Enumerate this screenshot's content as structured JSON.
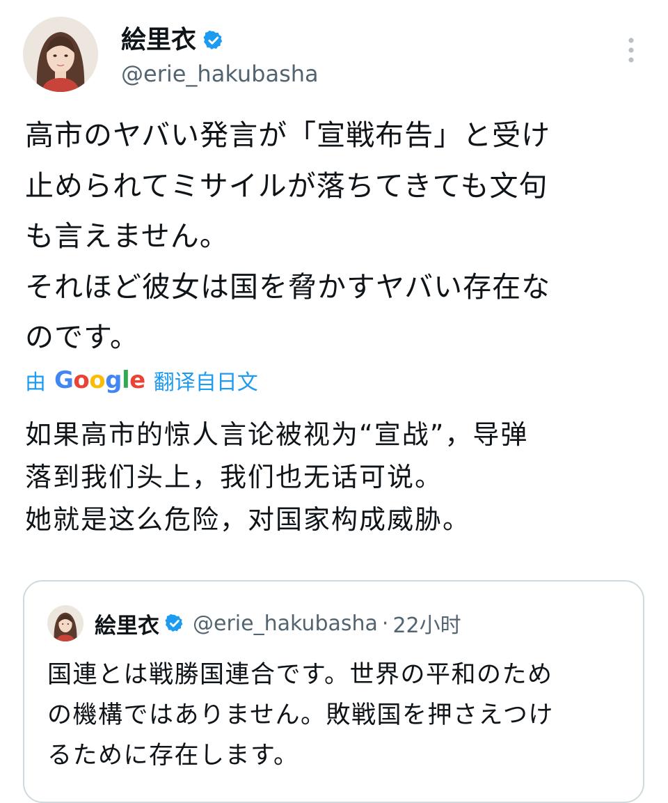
{
  "tweet": {
    "author": {
      "display_name": "絵里衣",
      "handle": "@erie_hakubasha",
      "verified": true,
      "avatar_icon": "avatar-icon",
      "verified_icon": "verified-badge-icon"
    },
    "more_icon": "more-vertical-icon",
    "text_lines": [
      "高市のヤバい発言が「宣戦布告」と受け",
      "止められてミサイルが落ちてきても文句",
      "も言えません。",
      "それほど彼女は国を脅かすヤバい存在な",
      "のです。"
    ],
    "translation": {
      "prefix": "由",
      "provider": "Google",
      "suffix": "翻译自日文",
      "link_color": "#1d9bf0",
      "text_lines": [
        "如果高市的惊人言论被视为“宣战”，导弹",
        "落到我们头上，我们也无话可说。",
        "她就是这么危险，对国家构成威胁。"
      ]
    },
    "quoted": {
      "display_name": "絵里衣",
      "handle": "@erie_hakubasha",
      "separator": "·",
      "time": "22小时",
      "text_lines": [
        "国連とは戦勝国連合です。世界の平和のため",
        "の機構ではありません。敗戦国を押さえつけ",
        "るために存在します。"
      ]
    }
  },
  "colors": {
    "text": "#0f1419",
    "secondary": "#536471",
    "accent": "#1d9bf0",
    "border": "#cfd9de"
  }
}
